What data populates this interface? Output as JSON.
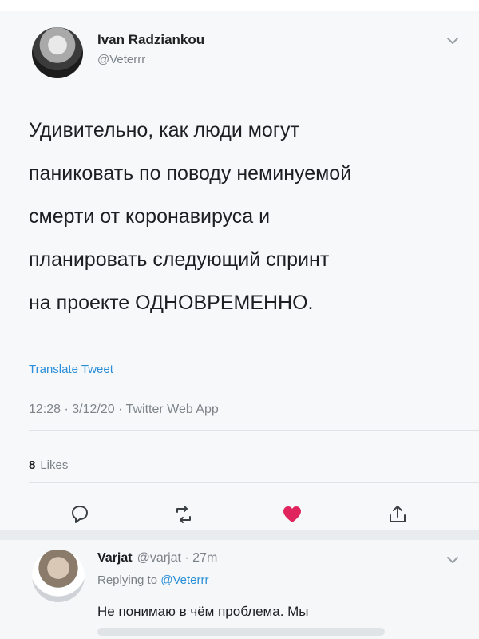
{
  "tweet": {
    "name": "Ivan Radziankou",
    "handle": "@Veterrr",
    "lines": [
      "Удивительно, как люди могут",
      "паниковать по поводу неминуемой",
      "смерти от коронавируса и",
      "планировать следующий спринт",
      "на проекте ОДНОВРЕМЕННО."
    ],
    "translate": "Translate Tweet",
    "meta": "12:28 · 3/12/20 · Twitter Web App",
    "likes_count": "8",
    "likes_label": "Likes"
  },
  "icons": {
    "reply": "comment-icon",
    "retweet": "retweet-icon",
    "like": "heart-icon",
    "share": "share-icon",
    "menu": "chevron-down-icon"
  },
  "colors": {
    "link": "#2a8fd8",
    "like": "#e0245e"
  },
  "reply_tweet": {
    "name": "Varjat",
    "handle_time": "@varjat · 27m",
    "replying_prefix": "Replying to",
    "replying_to": "@Veterrr",
    "text": "Не понимаю в чём проблема. Мы"
  }
}
